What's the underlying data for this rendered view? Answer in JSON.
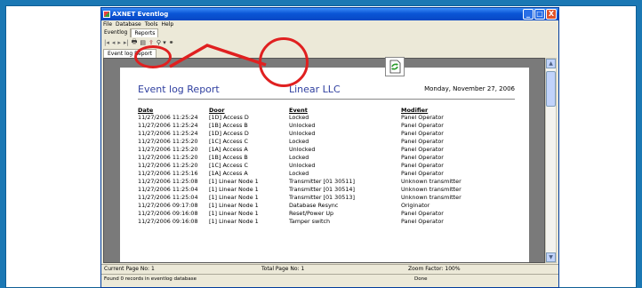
{
  "window": {
    "title": "AXNET Eventlog",
    "controls": [
      "_",
      "□",
      "X"
    ]
  },
  "menubar": [
    "File",
    "Database",
    "Tools",
    "Help"
  ],
  "top_tabs": [
    "Eventlog",
    "Reports"
  ],
  "toolbar_icons": [
    "first-page-icon",
    "prev-page-icon",
    "next-page-icon",
    "last-page-icon",
    "print-icon",
    "page-setup-icon",
    "export-icon",
    "zoom-icon",
    "binoculars-icon"
  ],
  "doc_tab": "Event log Report",
  "report": {
    "title": "Event log Report",
    "company": "Linear LLC",
    "date": "Monday, November 27, 2006",
    "headers": {
      "date": "Date",
      "door": "Door",
      "event": "Event",
      "modifier": "Modifier"
    },
    "rows": [
      {
        "date": "11/27/2006  11:25:24",
        "door": "[1D] Access D",
        "event": "Locked",
        "modifier": "Panel Operator"
      },
      {
        "date": "11/27/2006  11:25:24",
        "door": "[1B] Access B",
        "event": "Unlocked",
        "modifier": "Panel Operator"
      },
      {
        "date": "11/27/2006  11:25:24",
        "door": "[1D] Access D",
        "event": "Unlocked",
        "modifier": "Panel Operator"
      },
      {
        "date": "11/27/2006  11:25:20",
        "door": "[1C] Access C",
        "event": "Locked",
        "modifier": "Panel Operator"
      },
      {
        "date": "11/27/2006  11:25:20",
        "door": "[1A] Access A",
        "event": "Unlocked",
        "modifier": "Panel Operator"
      },
      {
        "date": "11/27/2006  11:25:20",
        "door": "[1B] Access B",
        "event": "Locked",
        "modifier": "Panel Operator"
      },
      {
        "date": "11/27/2006  11:25:20",
        "door": "[1C] Access C",
        "event": "Unlocked",
        "modifier": "Panel Operator"
      },
      {
        "date": "11/27/2006  11:25:16",
        "door": "[1A] Access A",
        "event": "Locked",
        "modifier": "Panel Operator"
      },
      {
        "date": "11/27/2006  11:25:08",
        "door": "[1] Linear Node 1",
        "event": "Transmitter [01 30511]",
        "modifier": "Unknown transmitter"
      },
      {
        "date": "11/27/2006  11:25:04",
        "door": "[1] Linear Node 1",
        "event": "Transmitter [01 30514]",
        "modifier": "Unknown transmitter"
      },
      {
        "date": "11/27/2006  11:25:04",
        "door": "[1] Linear Node 1",
        "event": "Transmitter [01 30513]",
        "modifier": "Unknown transmitter"
      },
      {
        "date": "11/27/2006  09:17:08",
        "door": "[1] Linear Node 1",
        "event": "Database Resync",
        "modifier": "Originator"
      },
      {
        "date": "11/27/2006  09:16:08",
        "door": "[1] Linear Node 1",
        "event": "Reset/Power Up",
        "modifier": "Panel Operator"
      },
      {
        "date": "11/27/2006  09:16:08",
        "door": "[1] Linear Node 1",
        "event": "Tamper switch",
        "modifier": "Panel Operator"
      }
    ]
  },
  "status": {
    "current_page": "Current Page No: 1",
    "total_page": "Total Page No: 1",
    "zoom": "Zoom Factor: 100%",
    "message": "Found 0 records in eventlog database",
    "state": "Done"
  },
  "colors": {
    "accent": "#e02020",
    "background": "#1b78b4",
    "report_title": "#3040a0"
  }
}
